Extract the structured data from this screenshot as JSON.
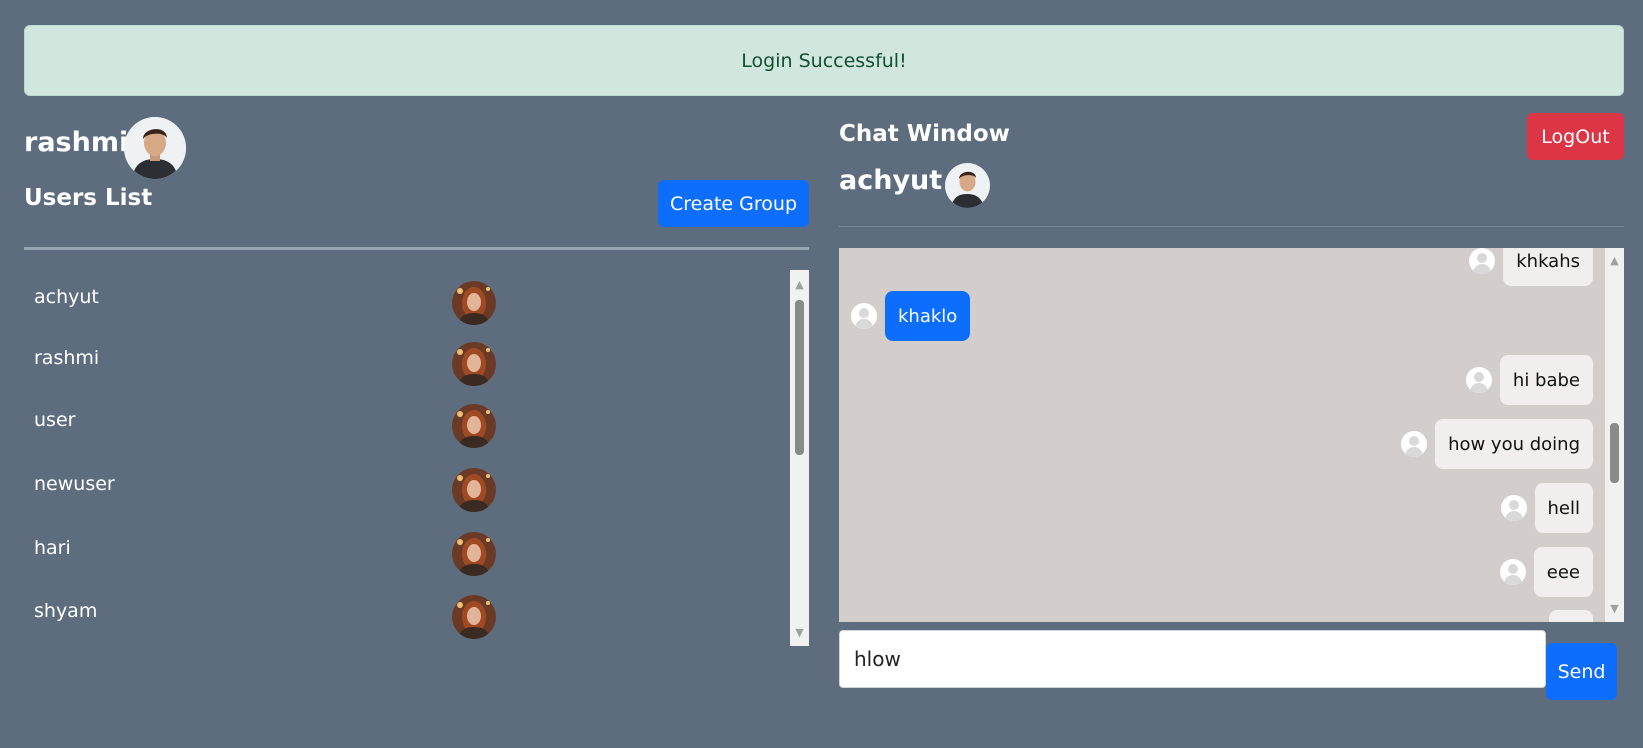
{
  "alert": {
    "text": "Login Successful!"
  },
  "current_user": {
    "name": "rashmi"
  },
  "users_panel": {
    "title": "Users List",
    "create_group_label": "Create Group",
    "users": [
      "achyut",
      "rashmi",
      "user",
      "newuser",
      "hari",
      "shyam"
    ]
  },
  "chat": {
    "title": "Chat Window",
    "recipient": "achyut",
    "logout_label": "LogOut",
    "messages": [
      {
        "text": "khkahs",
        "direction": "incoming"
      },
      {
        "text": "khaklo",
        "direction": "outgoing"
      },
      {
        "text": "hi babe",
        "direction": "incoming"
      },
      {
        "text": "how you doing",
        "direction": "incoming"
      },
      {
        "text": "hell",
        "direction": "incoming"
      },
      {
        "text": "eee",
        "direction": "incoming"
      }
    ],
    "input_value": "hlow",
    "send_label": "Send"
  },
  "colors": {
    "background": "#5d6d7e",
    "primary": "#0d6efd",
    "danger": "#dc3545",
    "success_bg": "#d1e7dd",
    "chat_bg": "#d3cecb"
  }
}
